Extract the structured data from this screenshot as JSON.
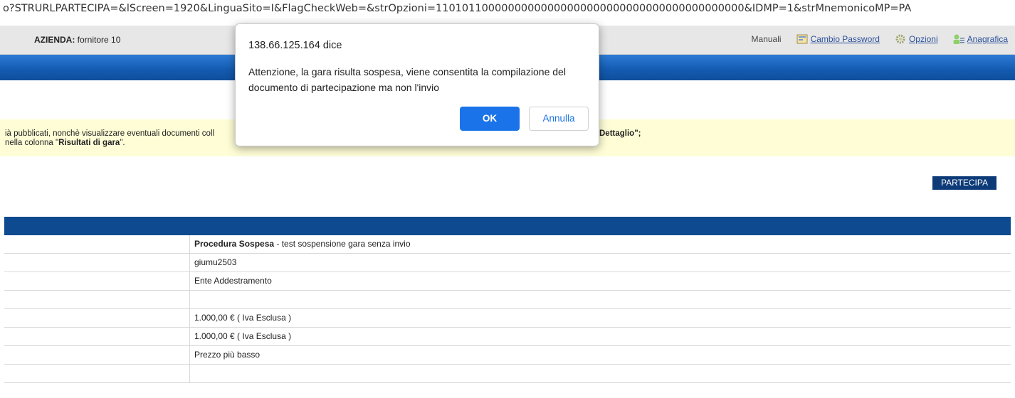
{
  "browser": {
    "url": "o?STRURLPARTECIPA=&lScreen=1920&LinguaSito=I&FlagCheckWeb=&strOpzioni=11010110000000000000000000000000000000000000000&IDMP=1&strMnemonicoMP=PA"
  },
  "header": {
    "azienda_label": "AZIENDA:",
    "azienda_value": "fornitore 10",
    "nav": {
      "manuali": "Manuali",
      "cambio_password": "Cambio Password",
      "opzioni": "Opzioni",
      "anagrafica": "Anagrafica"
    }
  },
  "info": {
    "line1_left": "ià pubblicati, nonchè visualizzare eventuali documenti coll",
    "line1_right": "Dettaglio\";",
    "line2_prefix": "nella colonna \"",
    "line2_bold": "Risultati di gara",
    "line2_suffix": "\"."
  },
  "actions": {
    "partecipa": "PARTECIPA"
  },
  "details": {
    "rows": [
      {
        "bold": "Procedura Sospesa",
        "text": " - test sospensione gara senza invio"
      },
      {
        "bold": "",
        "text": "giumu2503"
      },
      {
        "bold": "",
        "text": "Ente Addestramento"
      },
      {
        "bold": "",
        "text": ""
      },
      {
        "bold": "",
        "text": "1.000,00 € ( Iva Esclusa )"
      },
      {
        "bold": "",
        "text": "1.000,00 € ( Iva Esclusa )"
      },
      {
        "bold": "",
        "text": "Prezzo più basso"
      },
      {
        "bold": "",
        "text": ""
      }
    ]
  },
  "dialog": {
    "title": "138.66.125.164 dice",
    "message": "Attenzione, la gara risulta sospesa, viene consentita la compilazione del documento di partecipazione ma non l'invio",
    "ok": "OK",
    "cancel": "Annulla"
  },
  "colors": {
    "header_blue": "#135ab0",
    "table_header_blue": "#0d4a8f",
    "button_navy": "#0d3b78",
    "info_yellow": "#fefdd6",
    "dialog_ok_blue": "#1a73e8"
  }
}
